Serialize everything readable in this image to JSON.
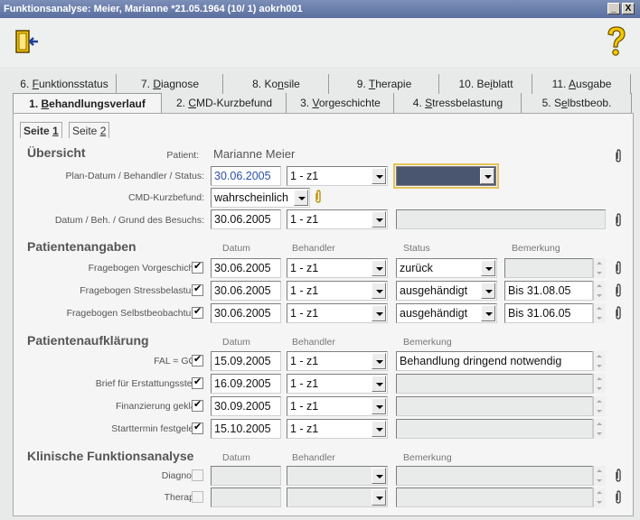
{
  "window": {
    "title": "Funktionsanalyse: Meier, Marianne *21.05.1964 (10/ 1) aokrh001",
    "minimize": "_",
    "close": "X"
  },
  "tabs": {
    "row1": [
      {
        "pre": "6. ",
        "u": "F",
        "post": "unktionsstatus"
      },
      {
        "pre": "7. ",
        "u": "D",
        "post": "iagnose"
      },
      {
        "pre": "8. Ko",
        "u": "n",
        "post": "sile"
      },
      {
        "pre": "9. ",
        "u": "T",
        "post": "herapie"
      },
      {
        "pre": "10. Be",
        "u": "i",
        "post": "blatt"
      },
      {
        "pre": "11. ",
        "u": "A",
        "post": "usgabe"
      }
    ],
    "row2": [
      {
        "pre": "1. ",
        "u": "B",
        "post": "ehandlungsverlauf"
      },
      {
        "pre": "2. ",
        "u": "C",
        "post": "MD-Kurzbefund"
      },
      {
        "pre": "3. ",
        "u": "V",
        "post": "orgeschichte"
      },
      {
        "pre": "4. ",
        "u": "S",
        "post": "tressbelastung"
      },
      {
        "pre": "5. S",
        "u": "e",
        "post": "lbstbeob."
      }
    ]
  },
  "subtabs": [
    {
      "pre": "Seite ",
      "u": "1"
    },
    {
      "pre": "Seite ",
      "u": "2"
    }
  ],
  "uebersicht": {
    "heading": "Übersicht",
    "patient_label": "Patient:",
    "patient_name": "Marianne Meier",
    "plan_label": "Plan-Datum / Behandler / Status:",
    "plan_date": "30.06.2005",
    "plan_behandler": "1 - z1",
    "cmd_label": "CMD-Kurzbefund:",
    "cmd_value": "wahrscheinlich",
    "visit_label": "Datum / Beh. / Grund des Besuchs:",
    "visit_date": "30.06.2005",
    "visit_behandler": "1 - z1"
  },
  "patientenangaben": {
    "heading": "Patientenangaben",
    "col_datum": "Datum",
    "col_behandler": "Behandler",
    "col_status": "Status",
    "col_bemerkung": "Bemerkung",
    "rows": [
      {
        "label": "Fragebogen Vorgeschichte:",
        "date": "30.06.2005",
        "behandler": "1 - z1",
        "status": "zurück",
        "bemerkung": ""
      },
      {
        "label": "Fragebogen Stressbelastung:",
        "date": "30.06.2005",
        "behandler": "1 - z1",
        "status": "ausgehändigt",
        "bemerkung": "Bis 31.08.05"
      },
      {
        "label": "Fragebogen Selbstbeobachtung:",
        "date": "30.06.2005",
        "behandler": "1 - z1",
        "status": "ausgehändigt",
        "bemerkung": "Bis 31.06.05"
      }
    ]
  },
  "aufklaerung": {
    "heading": "Patientenaufklärung",
    "col_datum": "Datum",
    "col_behandler": "Behandler",
    "col_bemerkung": "Bemerkung",
    "rows": [
      {
        "label": "FAL = GOZ:",
        "date": "15.09.2005",
        "behandler": "1 - z1",
        "bemerkung": "Behandlung dringend notwendig"
      },
      {
        "label": "Brief für Erstattungsstelle:",
        "date": "16.09.2005",
        "behandler": "1 - z1",
        "bemerkung": ""
      },
      {
        "label": "Finanzierung geklärt:",
        "date": "30.09.2005",
        "behandler": "1 - z1",
        "bemerkung": ""
      },
      {
        "label": "Starttermin festgelegt:",
        "date": "15.10.2005",
        "behandler": "1 - z1",
        "bemerkung": ""
      }
    ]
  },
  "klinisch": {
    "heading": "Klinische Funktionsanalyse",
    "col_datum": "Datum",
    "col_behandler": "Behandler",
    "col_bemerkung": "Bemerkung",
    "rows": [
      {
        "label": "Diagnose:"
      },
      {
        "label": "Therapie:"
      }
    ]
  },
  "colors": {
    "title_bg": "#5a6f9f",
    "date_text": "#2a4fa8",
    "highlight": "#e6c35a"
  },
  "icons": [
    "exit-icon",
    "help-icon",
    "paperclip-icon",
    "dropdown-arrow-icon"
  ]
}
